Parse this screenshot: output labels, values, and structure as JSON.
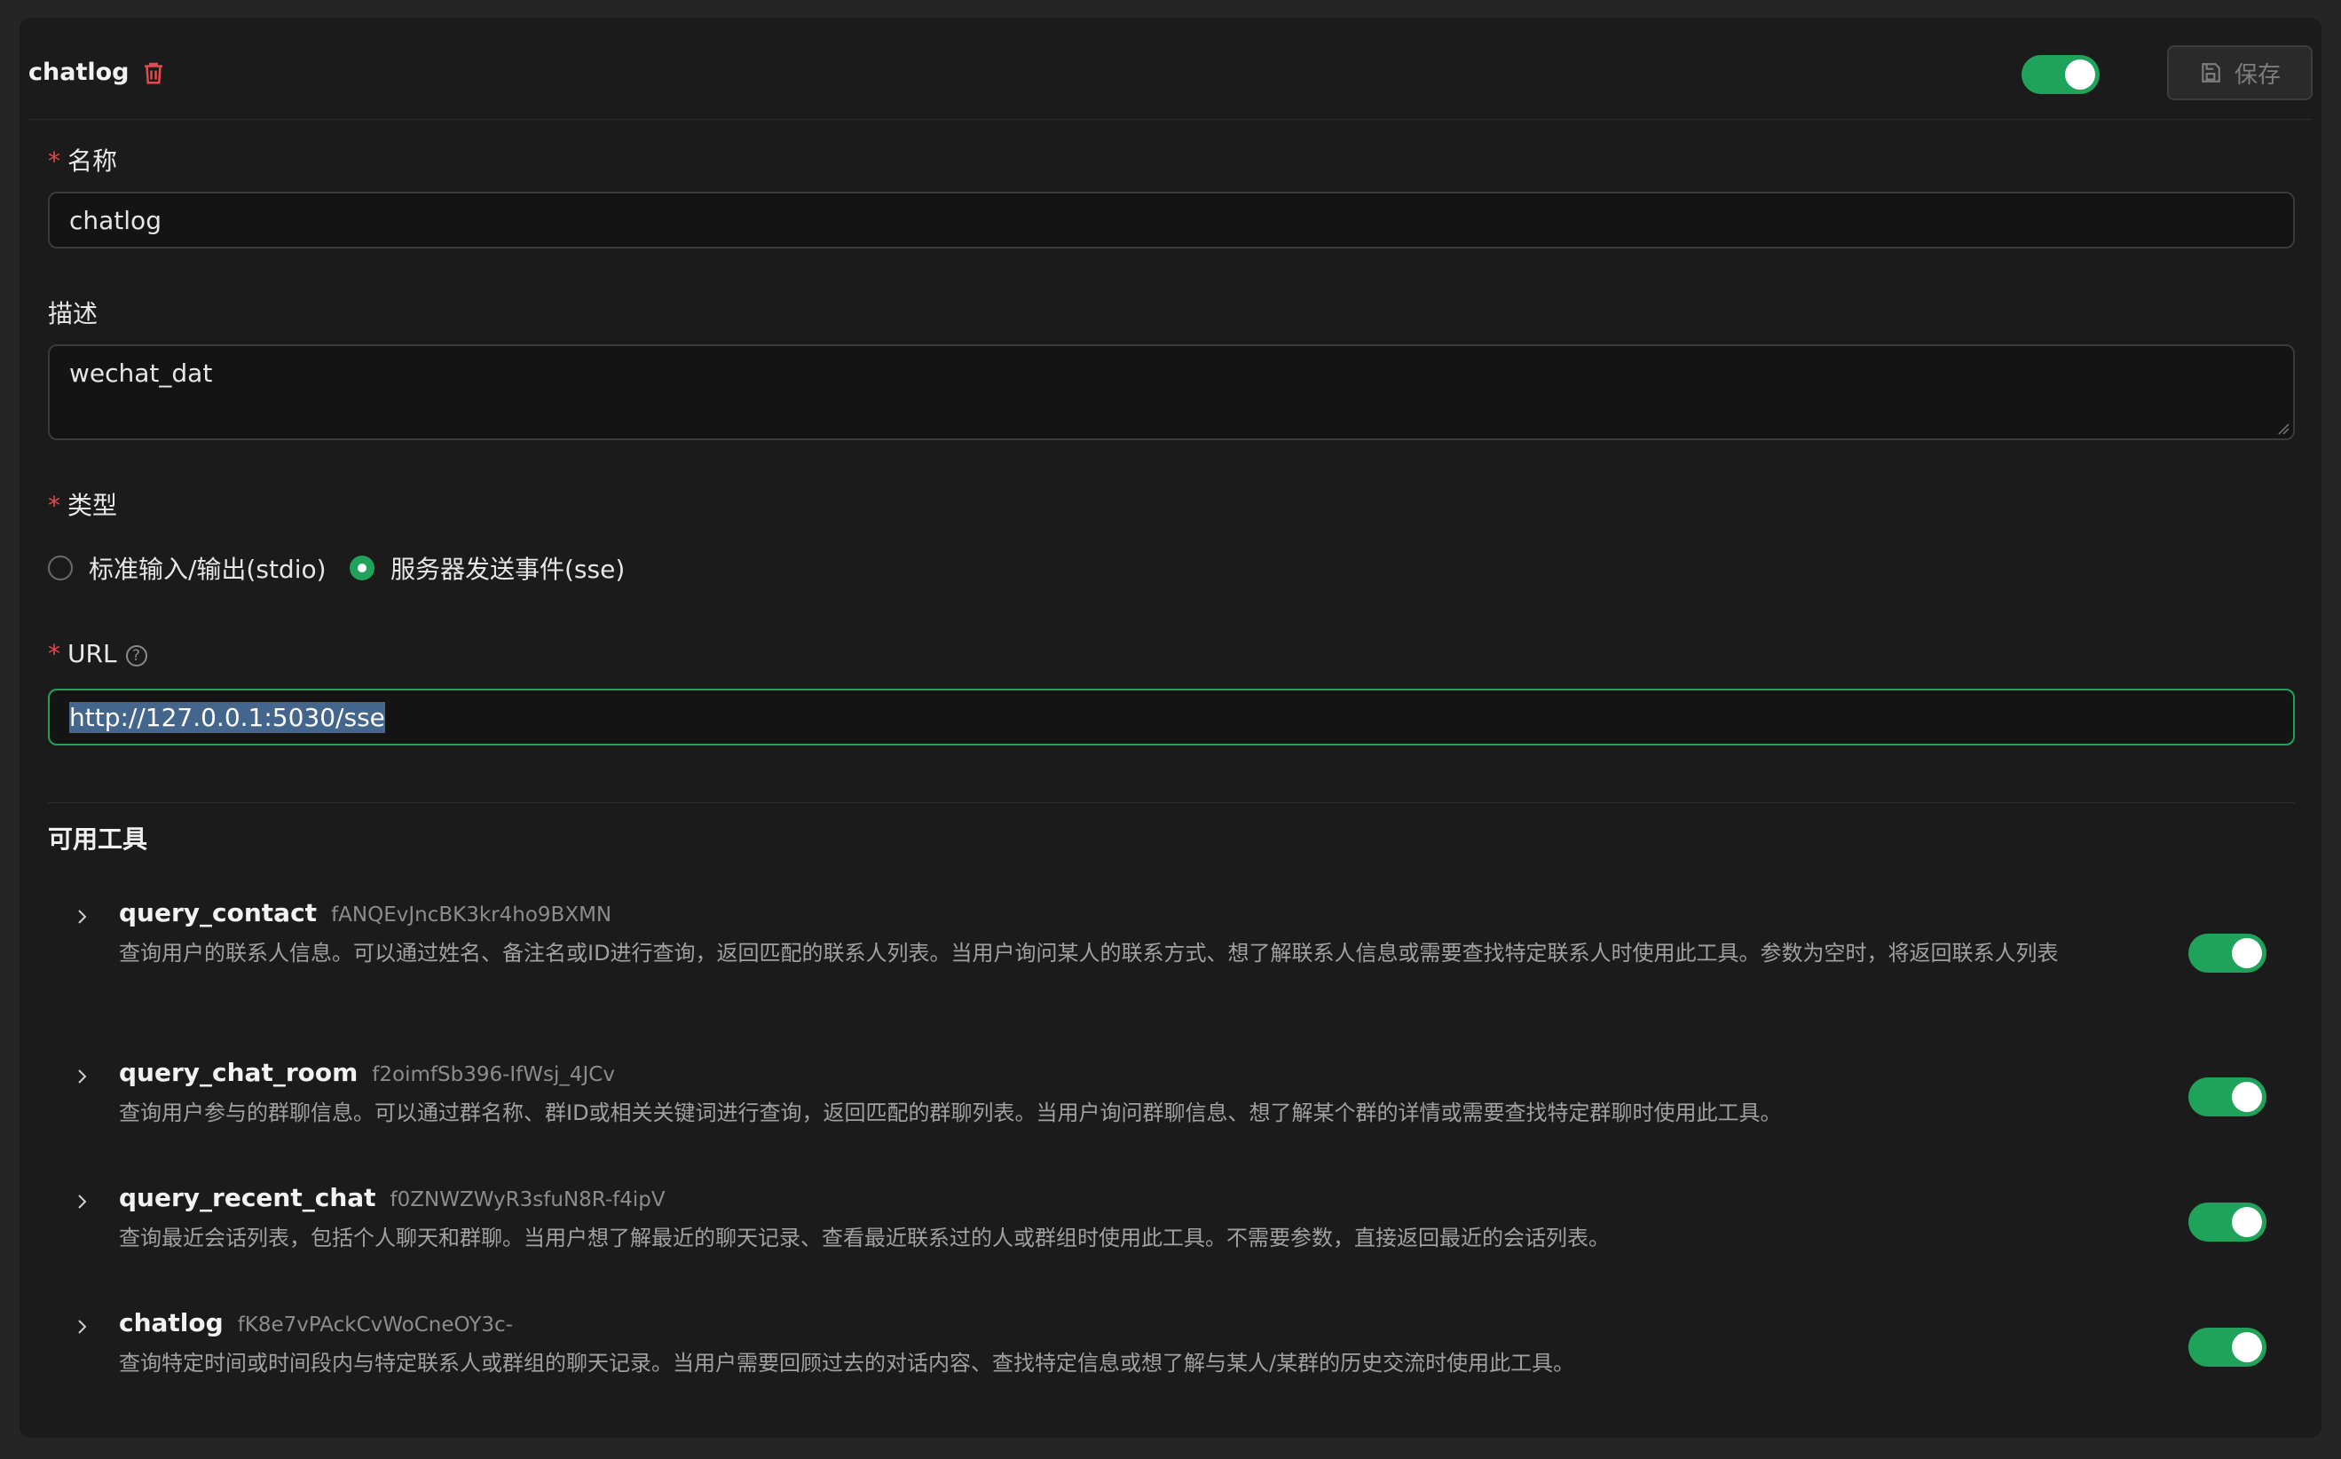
{
  "header": {
    "title": "chatlog",
    "enabled": true,
    "save_label": "保存"
  },
  "form": {
    "name": {
      "label": "名称",
      "required_mark": "*",
      "value": "chatlog"
    },
    "description": {
      "label": "描述",
      "value": "wechat_dat"
    },
    "type": {
      "label": "类型",
      "required_mark": "*",
      "options": [
        {
          "label": "标准输入/输出(stdio)",
          "selected": false
        },
        {
          "label": "服务器发送事件(sse)",
          "selected": true
        }
      ]
    },
    "url": {
      "label": "URL",
      "required_mark": "*",
      "help_icon": "question-circle-icon",
      "value": "http://127.0.0.1:5030/sse"
    }
  },
  "tools": {
    "title": "可用工具",
    "items": [
      {
        "name": "query_contact",
        "id": "fANQEvJncBK3kr4ho9BXMN",
        "description": "查询用户的联系人信息。可以通过姓名、备注名或ID进行查询，返回匹配的联系人列表。当用户询问某人的联系方式、想了解联系人信息或需要查找特定联系人时使用此工具。参数为空时，将返回联系人列表",
        "enabled": true
      },
      {
        "name": "query_chat_room",
        "id": "f2oimfSb396-IfWsj_4JCv",
        "description": "查询用户参与的群聊信息。可以通过群名称、群ID或相关关键词进行查询，返回匹配的群聊列表。当用户询问群聊信息、想了解某个群的详情或需要查找特定群聊时使用此工具。",
        "enabled": true
      },
      {
        "name": "query_recent_chat",
        "id": "f0ZNWZWyR3sfuN8R-f4ipV",
        "description": "查询最近会话列表，包括个人聊天和群聊。当用户想了解最近的聊天记录、查看最近联系过的人或群组时使用此工具。不需要参数，直接返回最近的会话列表。",
        "enabled": true
      },
      {
        "name": "chatlog",
        "id": "fK8e7vPAckCvWoCneOY3c-",
        "description": "查询特定时间或时间段内与特定联系人或群组的聊天记录。当用户需要回顾过去的对话内容、查找特定信息或想了解与某人/某群的历史交流时使用此工具。",
        "enabled": true
      }
    ]
  },
  "colors": {
    "accent": "#1fa35b",
    "danger": "#e5484d",
    "panel": "#1b1b1b",
    "background": "#252525"
  }
}
